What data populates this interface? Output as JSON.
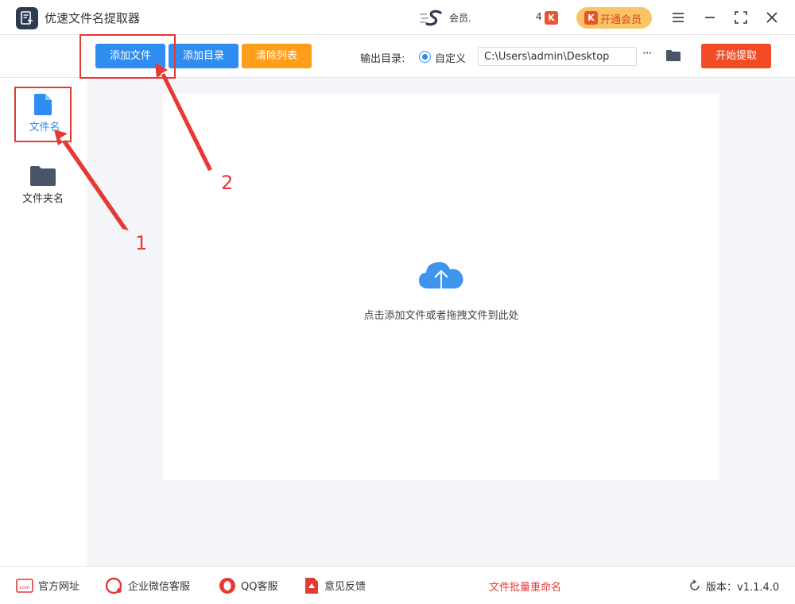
{
  "window": {
    "title": "优速文件名提取器",
    "user_name": "会员.",
    "k_count": "4",
    "k_icon_letter": "K",
    "vip_label": "开通会员"
  },
  "toolbar": {
    "add_file_label": "添加文件",
    "add_dir_label": "添加目录",
    "clear_label": "清除列表",
    "output_dir_label": "输出目录:",
    "custom_label": "自定义",
    "output_path": "C:\\Users\\admin\\Desktop",
    "more_label": "···",
    "start_label": "开始提取"
  },
  "sidebar": {
    "items": [
      {
        "label": "文件名",
        "active": true
      },
      {
        "label": "文件夹名",
        "active": false
      }
    ]
  },
  "main": {
    "drop_hint": "点击添加文件或者拖拽文件到此处"
  },
  "footer": {
    "website": "官方网址",
    "wechat": "企业微信客服",
    "qq": "QQ客服",
    "feedback": "意见反馈",
    "center_link": "文件批量重命名",
    "version": "版本：v1.1.4.0"
  },
  "annotations": {
    "step1": "1",
    "step2": "2"
  },
  "colors": {
    "primary": "#2f8cf0",
    "orange": "#ff9e1b",
    "start_red": "#f24b26",
    "annotation_red": "#e53935",
    "vip_yellow": "#f9c466"
  }
}
